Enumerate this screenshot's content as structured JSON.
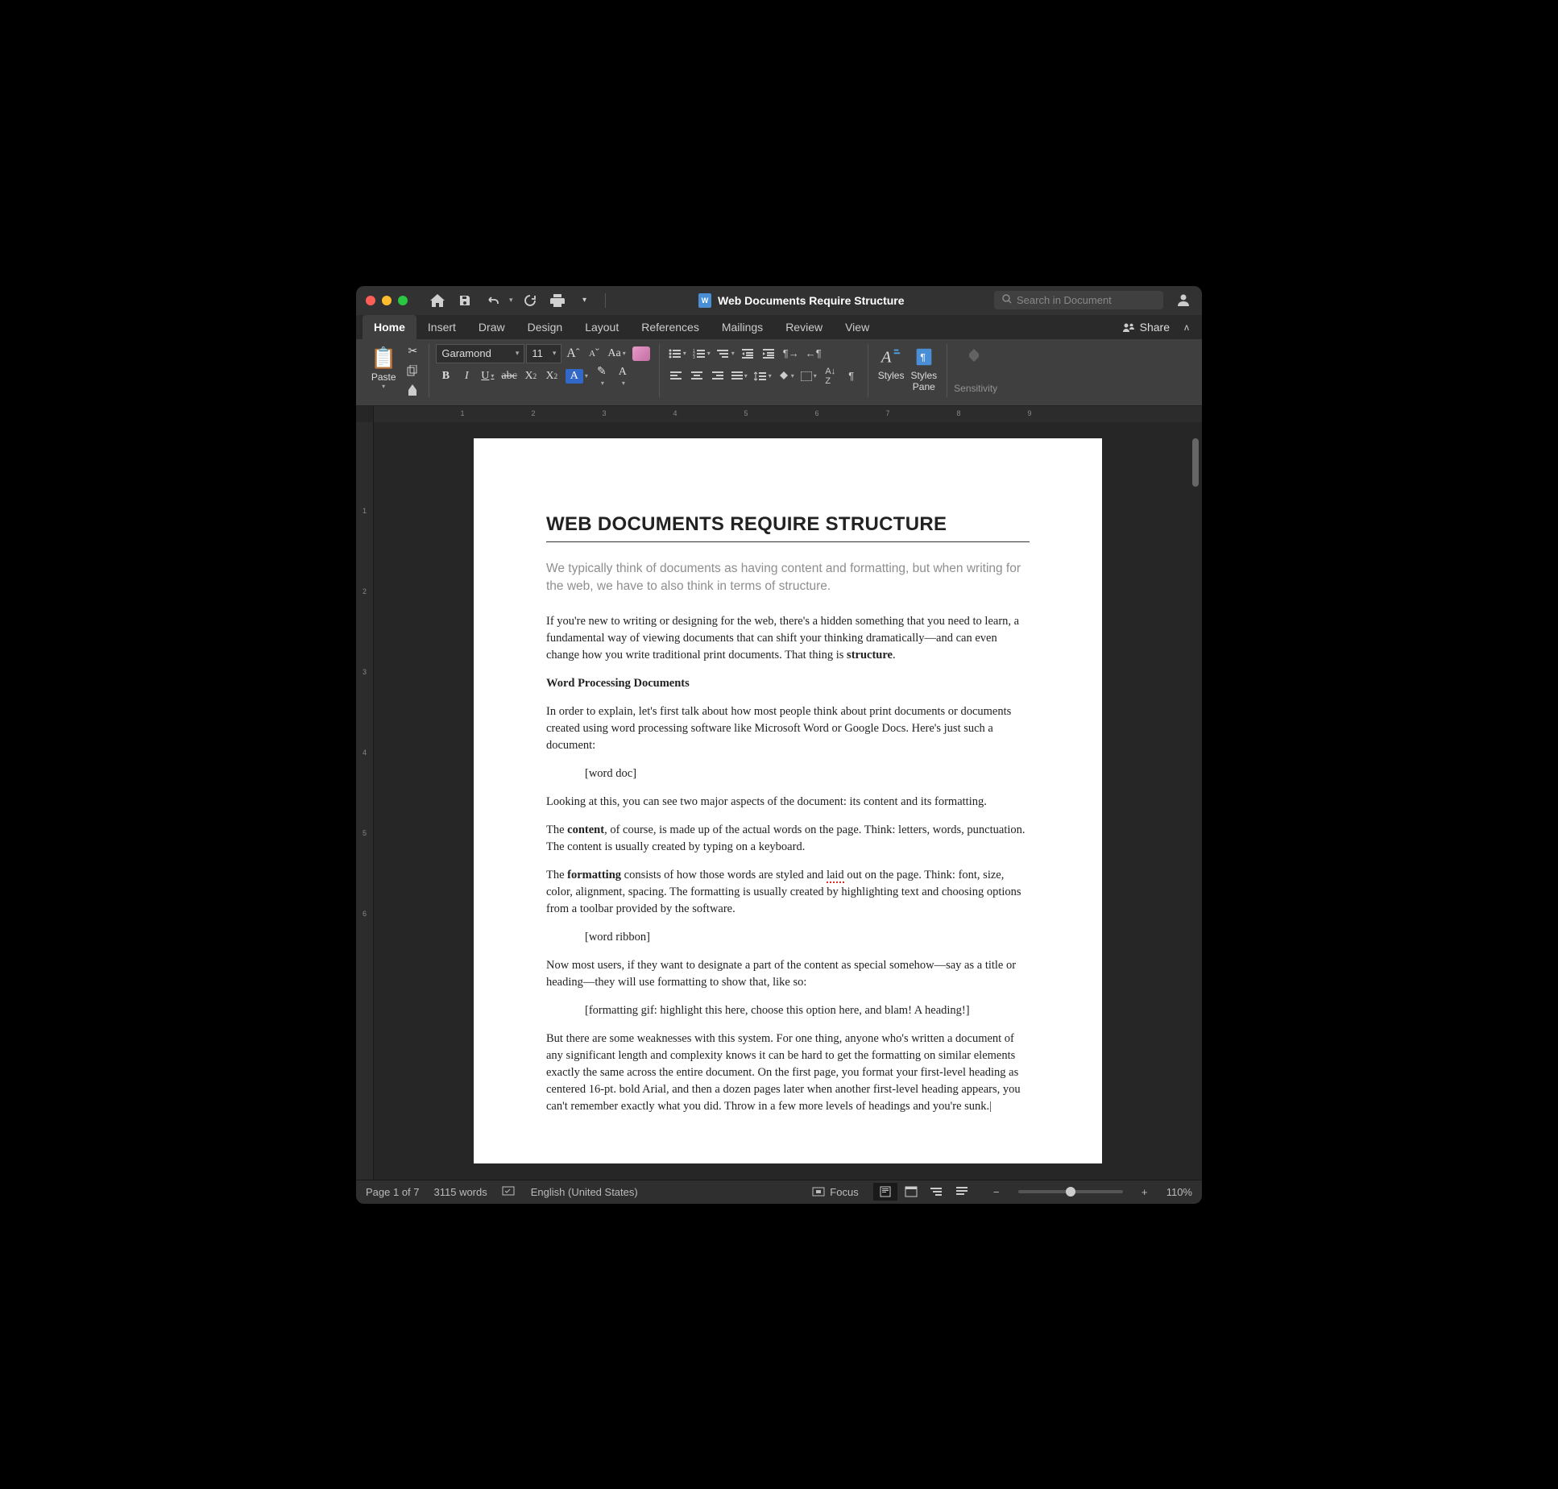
{
  "titlebar": {
    "doc_title": "Web Documents Require Structure",
    "search_placeholder": "Search in Document"
  },
  "tabs": {
    "items": [
      {
        "label": "Home",
        "active": true
      },
      {
        "label": "Insert"
      },
      {
        "label": "Draw"
      },
      {
        "label": "Design"
      },
      {
        "label": "Layout"
      },
      {
        "label": "References"
      },
      {
        "label": "Mailings"
      },
      {
        "label": "Review"
      },
      {
        "label": "View"
      }
    ],
    "share_label": "Share"
  },
  "ribbon": {
    "paste_label": "Paste",
    "font_name": "Garamond",
    "font_size": "11",
    "styles_label": "Styles",
    "styles_pane_label": "Styles\nPane",
    "sensitivity_label": "Sensitivity"
  },
  "ruler": {
    "h_labels": [
      "1",
      "2",
      "3",
      "4",
      "5",
      "6",
      "7",
      "8",
      "9"
    ],
    "v_labels": [
      "1",
      "2",
      "3",
      "4",
      "5",
      "6"
    ]
  },
  "document": {
    "heading": "WEB DOCUMENTS REQUIRE STRUCTURE",
    "subtitle": "We typically think of documents as having content and formatting, but when writing for the web, we have to also think in terms of structure.",
    "p1a": "If you're new to writing or designing for the web, there's a hidden something that you need to learn, a fundamental way of viewing documents that can shift your thinking dramatically—and can even change how you write traditional print documents. That thing is ",
    "p1b_strong": "structure",
    "p1c": ".",
    "p2_strong": "Word Processing Documents",
    "p3": "In order to explain, let's first talk about how most people think about print documents or documents created using word processing software like Microsoft Word or Google Docs. Here's just such a document:",
    "p4": "[word doc]",
    "p5": "Looking at this, you can see two major aspects of the document: its content and its formatting.",
    "p6a": "The ",
    "p6b_strong": "content",
    "p6c": ", of course, is made up of the actual words on the page. Think: letters, words, punctuation. The content is usually created by typing on a keyboard.",
    "p7a": "The ",
    "p7b_strong": "formatting",
    "p7c": " consists of how those words are styled and ",
    "p7d_spell": "laid",
    "p7e": " out on the page. Think: font, size, color, alignment, spacing. The formatting is usually created by highlighting text and choosing options from a toolbar provided by the software.",
    "p8": "[word ribbon]",
    "p9": "Now most users, if they want to designate a part of the content as special somehow—say as a title or heading—they will use formatting to show that, like so:",
    "p10": "[formatting gif: highlight this here, choose this option here, and blam! A heading!]",
    "p11": "But there are some weaknesses with this system. For one thing, anyone who's written a document of any significant length and complexity knows it can be hard to get the formatting on similar elements exactly the same across the entire document. On the first page, you format your first-level heading as centered 16-pt. bold Arial, and then a dozen pages later when another first-level heading appears, you can't remember exactly what you did. Throw in a few more levels of headings and you're sunk."
  },
  "statusbar": {
    "page_info": "Page 1 of 7",
    "word_count": "3115 words",
    "language": "English (United States)",
    "focus_label": "Focus",
    "zoom_pct": "110%"
  }
}
